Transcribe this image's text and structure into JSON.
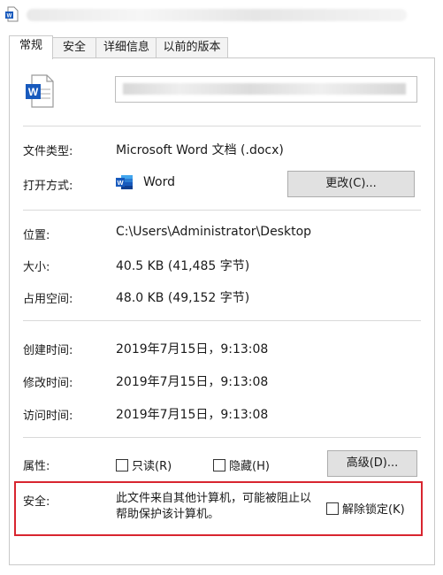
{
  "tabs": [
    "常规",
    "安全",
    "详细信息",
    "以前的版本"
  ],
  "rows": {
    "file_type": {
      "label": "文件类型:",
      "value": "Microsoft Word 文档 (.docx)"
    },
    "open_with": {
      "label": "打开方式:",
      "value": "Word",
      "button": "更改(C)..."
    },
    "location": {
      "label": "位置:",
      "value": "C:\\Users\\Administrator\\Desktop"
    },
    "size": {
      "label": "大小:",
      "value": "40.5 KB (41,485 字节)"
    },
    "size_on_disk": {
      "label": "占用空间:",
      "value": "48.0 KB (49,152 字节)"
    },
    "created": {
      "label": "创建时间:",
      "value": "2019年7月15日，9:13:08"
    },
    "modified": {
      "label": "修改时间:",
      "value": "2019年7月15日，9:13:08"
    },
    "accessed": {
      "label": "访问时间:",
      "value": "2019年7月15日，9:13:08"
    }
  },
  "attributes": {
    "label": "属性:",
    "readonly": "只读(R)",
    "hidden": "隐藏(H)",
    "advanced_button": "高级(D)..."
  },
  "security": {
    "label": "安全:",
    "text": "此文件来自其他计算机，可能被阻止以帮助保护该计算机。",
    "unblock": "解除锁定(K)"
  },
  "colors": {
    "word_blue": "#185abd",
    "highlight_red": "#d8252f"
  },
  "icons": {
    "title": "word-document-icon",
    "large": "word-document-icon",
    "app": "word-app-icon"
  }
}
